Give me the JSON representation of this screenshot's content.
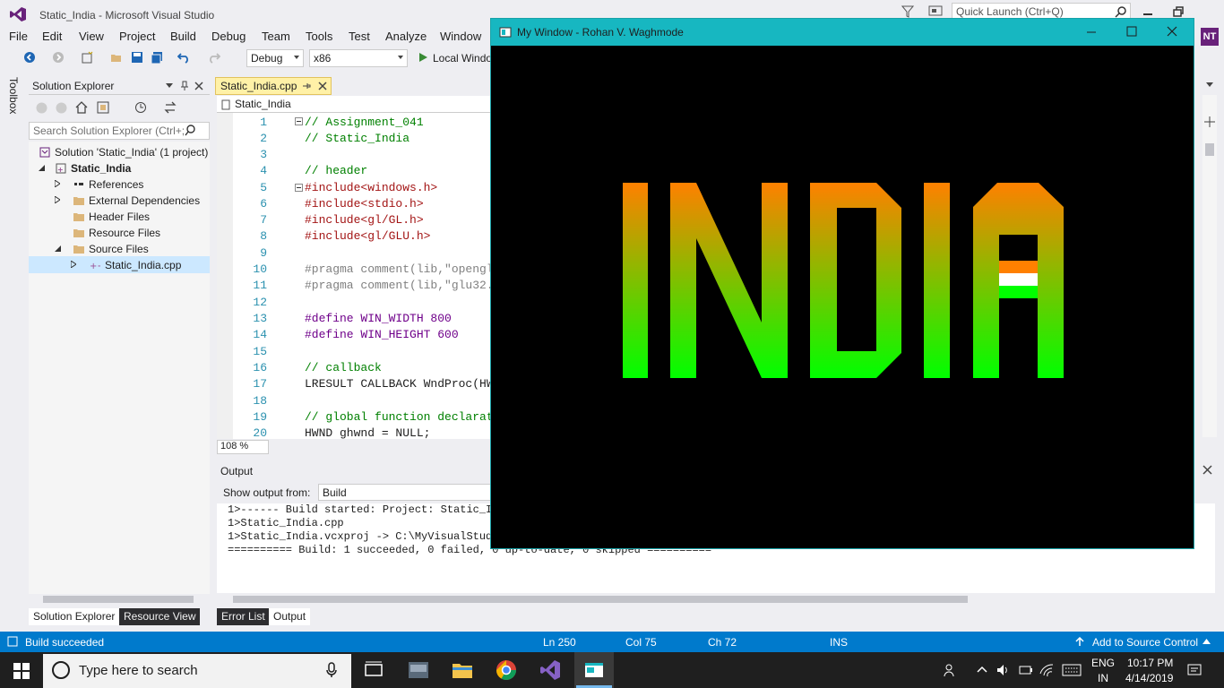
{
  "vs": {
    "title": "Static_India - Microsoft Visual Studio",
    "quick_launch": "Quick Launch (Ctrl+Q)",
    "user_initials": "NT",
    "menu": [
      "File",
      "Edit",
      "View",
      "Project",
      "Build",
      "Debug",
      "Team",
      "Tools",
      "Test",
      "Analyze",
      "Window"
    ],
    "toolbar": {
      "config": "Debug",
      "platform": "x86",
      "run_label": "Local Windo"
    }
  },
  "toolbox": {
    "label": "Toolbox"
  },
  "solution_explorer": {
    "title": "Solution Explorer",
    "search_placeholder": "Search Solution Explorer (Ctrl+;",
    "items": [
      {
        "label": "Solution 'Static_India' (1 project)"
      },
      {
        "label": "Static_India"
      },
      {
        "label": "References"
      },
      {
        "label": "External Dependencies"
      },
      {
        "label": "Header Files"
      },
      {
        "label": "Resource Files"
      },
      {
        "label": "Source Files"
      },
      {
        "label": "Static_India.cpp"
      }
    ],
    "bottom_tabs": [
      "Solution Explorer",
      "Resource View"
    ]
  },
  "editor": {
    "tab_label": "Static_India.cpp",
    "nav_label": "Static_India",
    "zoom": "108 %",
    "lines": [
      {
        "n": "1",
        "text": "// Assignment_041"
      },
      {
        "n": "2",
        "text": "// Static_India"
      },
      {
        "n": "3",
        "text": ""
      },
      {
        "n": "4",
        "text": "// header"
      },
      {
        "n": "5",
        "text": "#include<windows.h>"
      },
      {
        "n": "6",
        "text": "#include<stdio.h>"
      },
      {
        "n": "7",
        "text": "#include<gl/GL.h>"
      },
      {
        "n": "8",
        "text": "#include<gl/GLU.h>"
      },
      {
        "n": "9",
        "text": ""
      },
      {
        "n": "10",
        "text": "#pragma comment(lib,\"opengl"
      },
      {
        "n": "11",
        "text": "#pragma comment(lib,\"glu32."
      },
      {
        "n": "12",
        "text": ""
      },
      {
        "n": "13",
        "text": "#define WIN_WIDTH 800"
      },
      {
        "n": "14",
        "text": "#define WIN_HEIGHT 600"
      },
      {
        "n": "15",
        "text": ""
      },
      {
        "n": "16",
        "text": "// callback"
      },
      {
        "n": "17",
        "text": "LRESULT CALLBACK WndProc(HW"
      },
      {
        "n": "18",
        "text": ""
      },
      {
        "n": "19",
        "text": "// global function declarat"
      },
      {
        "n": "20",
        "text": "HWND ghwnd = NULL;"
      }
    ]
  },
  "output": {
    "title": "Output",
    "show_from_label": "Show output from:",
    "source": "Build",
    "lines": [
      "1>------ Build started: Project: Static_In",
      "1>Static_India.cpp",
      "1>Static_India.vcxproj -> C:\\MyVisualStudi",
      "========== Build: 1 succeeded, 0 failed, 0 up-to-date, 0 skipped =========="
    ],
    "bottom_tabs": [
      "Error List",
      "Output"
    ]
  },
  "status": {
    "message": "Build succeeded",
    "ln": "Ln 250",
    "col": "Col 75",
    "ch": "Ch 72",
    "mode": "INS",
    "source_control": "Add to Source Control"
  },
  "gl_window": {
    "title": "My Window - Rohan V. Waghmode",
    "colors": {
      "saffron": "#ff8000",
      "white": "#ffffff",
      "green": "#00ff00",
      "titlebar": "#17b7c1"
    }
  },
  "taskbar": {
    "search_placeholder": "Type here to search",
    "lang_top": "ENG",
    "lang_bottom": "IN",
    "time": "10:17 PM",
    "date": "4/14/2019"
  }
}
